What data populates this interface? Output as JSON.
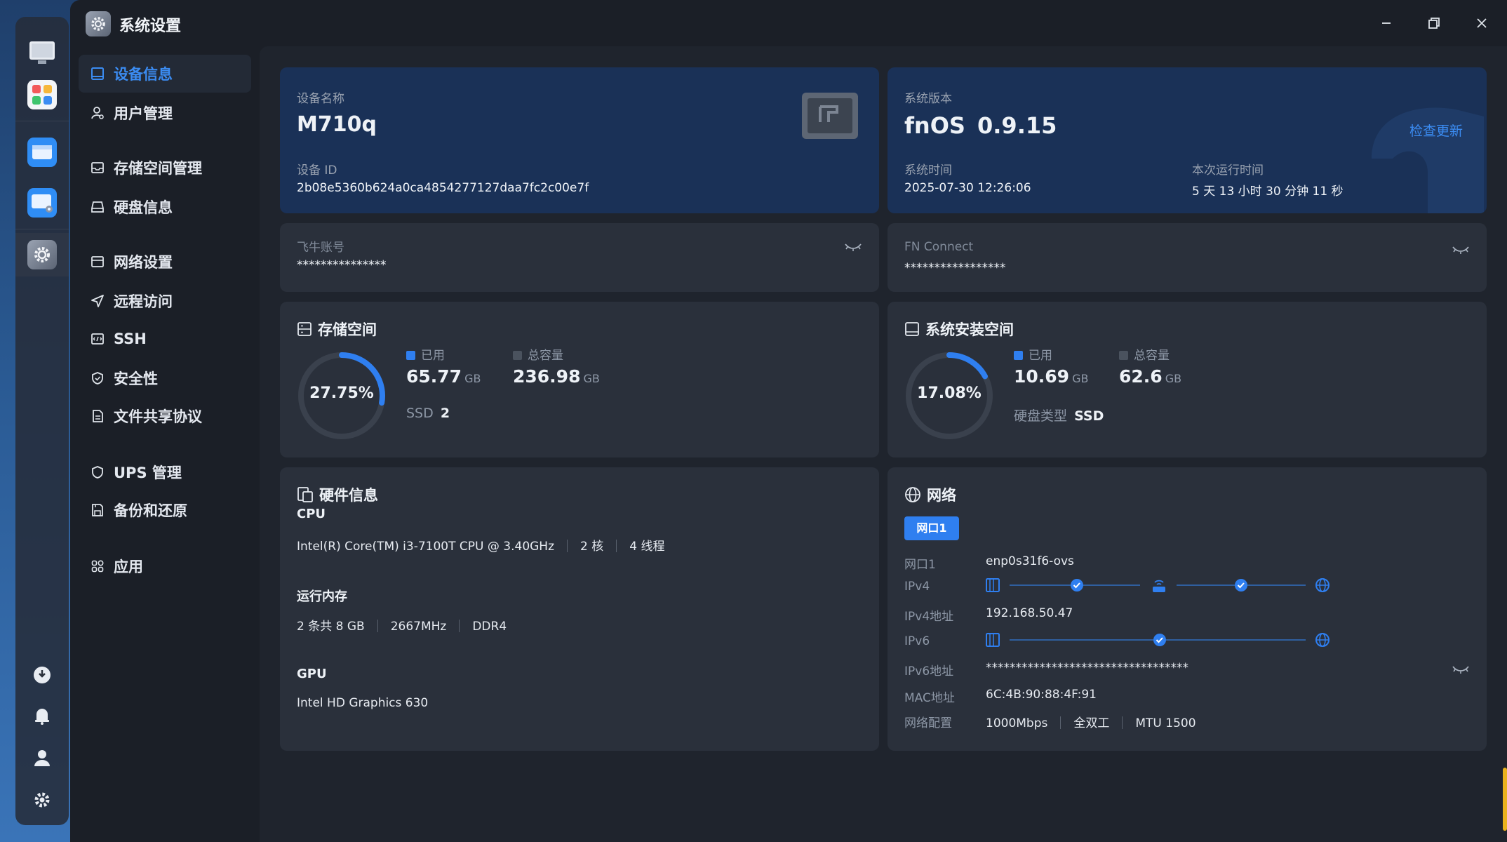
{
  "window": {
    "title": "系统设置"
  },
  "dock": {
    "apps": [
      {
        "name": "desktop-app",
        "icon": "monitor-icon"
      },
      {
        "name": "app-center",
        "icon": "app-grid-icon"
      },
      {
        "name": "file-manager",
        "icon": "folder-icon"
      },
      {
        "name": "file-manager-settings",
        "icon": "folder-gear-icon"
      },
      {
        "name": "system-settings",
        "icon": "gear-icon"
      }
    ],
    "system": [
      {
        "name": "update",
        "icon": "update-icon"
      },
      {
        "name": "notifications",
        "icon": "bell-icon"
      },
      {
        "name": "user",
        "icon": "user-icon"
      },
      {
        "name": "settings",
        "icon": "gear-icon"
      }
    ]
  },
  "sidebar": {
    "items": [
      {
        "label": "设备信息",
        "icon": "device-info-icon",
        "active": true
      },
      {
        "label": "用户管理",
        "icon": "user-manage-icon"
      },
      {
        "label": "存储空间管理",
        "icon": "storage-icon"
      },
      {
        "label": "硬盘信息",
        "icon": "disk-icon"
      },
      {
        "label": "网络设置",
        "icon": "network-settings-icon"
      },
      {
        "label": "远程访问",
        "icon": "send-icon"
      },
      {
        "label": "SSH",
        "icon": "terminal-icon"
      },
      {
        "label": "安全性",
        "icon": "shield-check-icon"
      },
      {
        "label": "文件共享协议",
        "icon": "document-icon"
      },
      {
        "label": "UPS 管理",
        "icon": "shield-icon"
      },
      {
        "label": "备份和还原",
        "icon": "backup-icon"
      },
      {
        "label": "应用",
        "icon": "apps-icon"
      }
    ]
  },
  "device": {
    "name_label": "设备名称",
    "name": "M710q",
    "id_label": "设备 ID",
    "id": "2b08e5360b624a0ca4854277127daa7fc2c00e7f"
  },
  "system": {
    "version_label": "系统版本",
    "os": "fnOS",
    "version": "0.9.15",
    "check_update": "检查更新",
    "time_label": "系统时间",
    "time": "2025-07-30 12:26:06",
    "uptime_label": "本次运行时间",
    "uptime": "5 天 13 小时 30 分钟 11 秒"
  },
  "accounts": {
    "feiniu_label": "飞牛账号",
    "feiniu_value": "***************",
    "fnconnect_label": "FN Connect",
    "fnconnect_value": "*****************"
  },
  "storage": {
    "title": "存储空间",
    "percent_text": "27.75%",
    "percent": 27.75,
    "used_label": "已用",
    "used": "65.77",
    "used_unit": "GB",
    "total_label": "总容量",
    "total": "236.98",
    "total_unit": "GB",
    "ssd_label": "SSD",
    "ssd_count": "2"
  },
  "system_space": {
    "title": "系统安装空间",
    "percent_text": "17.08%",
    "percent": 17.08,
    "used_label": "已用",
    "used": "10.69",
    "used_unit": "GB",
    "total_label": "总容量",
    "total": "62.6",
    "total_unit": "GB",
    "disk_type_label": "硬盘类型",
    "disk_type": "SSD"
  },
  "hardware": {
    "title": "硬件信息",
    "cpu_label": "CPU",
    "cpu_model": "Intel(R) Core(TM) i3-7100T CPU @ 3.40GHz",
    "cpu_cores": "2 核",
    "cpu_threads": "4 线程",
    "mem_label": "运行内存",
    "mem_size": "2 条共 8 GB",
    "mem_freq": "2667MHz",
    "mem_type": "DDR4",
    "gpu_label": "GPU",
    "gpu_model": "Intel HD Graphics 630"
  },
  "network": {
    "title": "网络",
    "tab": "网口1",
    "port_label": "网口1",
    "port_value": "enp0s31f6-ovs",
    "ipv4_label": "IPv4",
    "ipv4_addr_label": "IPv4地址",
    "ipv4_addr": "192.168.50.47",
    "ipv6_label": "IPv6",
    "ipv6_addr_label": "IPv6地址",
    "ipv6_addr": "**********************************",
    "mac_label": "MAC地址",
    "mac": "6C:4B:90:88:4F:91",
    "config_label": "网络配置",
    "speed": "1000Mbps",
    "duplex": "全双工",
    "mtu": "MTU 1500"
  },
  "colors": {
    "accent": "#2f7ff0",
    "card": "#2a303b",
    "card_dark": "#1a3157",
    "ring_track": "#3a414d"
  }
}
